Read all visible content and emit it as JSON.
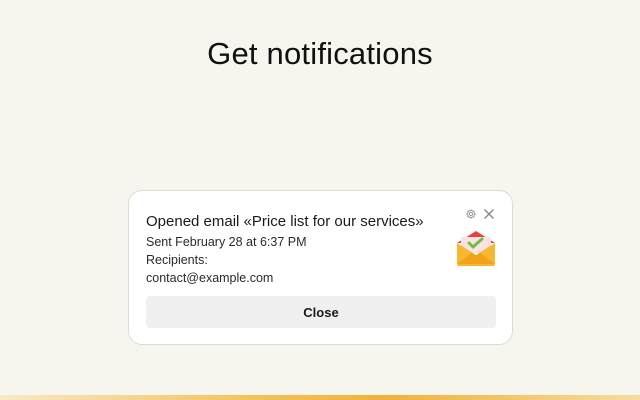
{
  "page": {
    "title": "Get notifications"
  },
  "notification": {
    "title": "Opened email «Price list for our services»",
    "sent": "Sent February 28 at 6:37 PM",
    "recipients_label": "Recipients:",
    "recipient": "contact@example.com",
    "close_label": "Close",
    "icons": {
      "settings": "gear-icon",
      "dismiss": "close-icon",
      "app": "envelope-icon"
    }
  },
  "colors": {
    "background": "#f6f5ee",
    "card": "#ffffff",
    "button": "#f0f0f0",
    "accent_bar": "#f0b13a",
    "envelope_red": "#e8413f",
    "envelope_yellow": "#f5b82e",
    "envelope_green": "#6cc04a"
  }
}
